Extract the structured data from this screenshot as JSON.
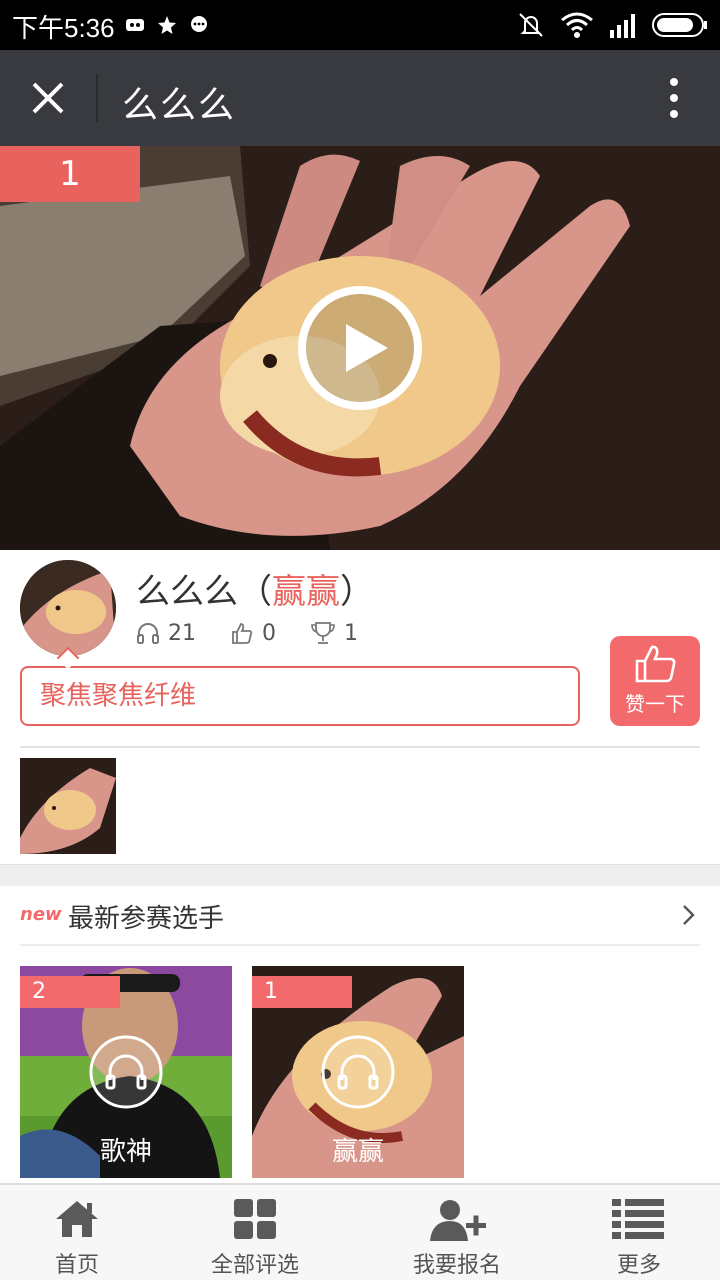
{
  "status_bar": {
    "time": "下午5:36"
  },
  "title_bar": {
    "title": "么么么",
    "close_icon": "close-icon",
    "more_icon": "more-vertical-icon"
  },
  "video": {
    "rank": "1",
    "play_icon": "play-icon"
  },
  "profile": {
    "name": "么么么",
    "paren_open": "（",
    "nickname": "赢赢",
    "paren_close": "）",
    "listens": "21",
    "likes": "0",
    "awards": "1",
    "description": "聚焦聚焦纤维",
    "like_button_label": "赞一下"
  },
  "newest": {
    "badge": "new",
    "title": "最新参赛选手",
    "cards": [
      {
        "rank": "2",
        "name": "歌神"
      },
      {
        "rank": "1",
        "name": "赢赢"
      }
    ]
  },
  "bottom_nav": [
    {
      "label": "首页",
      "icon": "home-icon"
    },
    {
      "label": "全部评选",
      "icon": "grid-icon"
    },
    {
      "label": "我要报名",
      "icon": "add-user-icon"
    },
    {
      "label": "更多",
      "icon": "list-icon"
    }
  ],
  "colors": {
    "accent": "#e8625e",
    "title_bar": "#393a3f",
    "status_bar": "#000000"
  }
}
